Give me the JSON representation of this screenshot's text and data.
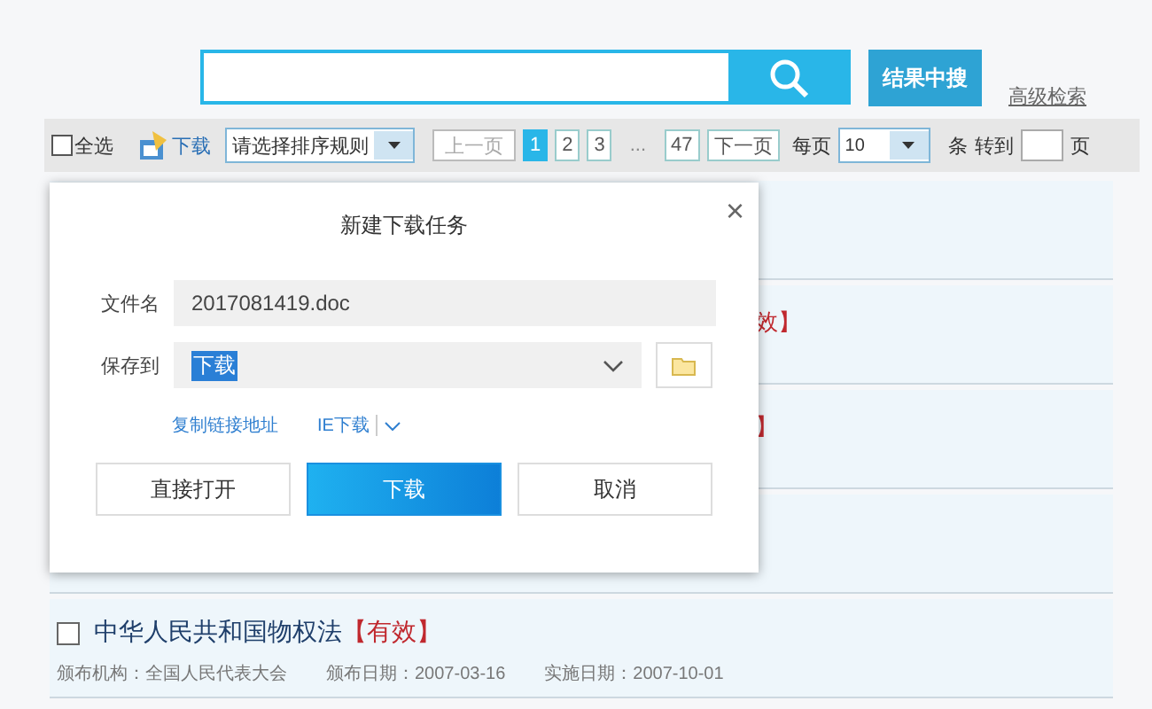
{
  "search": {
    "button_label": "结果中搜",
    "advanced_link": "高级检索"
  },
  "toolbar": {
    "select_all": {
      "label": "全选",
      "checked": false
    },
    "download": "下载",
    "sort_select": "请选择排序规则",
    "prev": "上一页",
    "pages": [
      {
        "label": "1",
        "selected": true
      },
      {
        "label": "2",
        "selected": false
      },
      {
        "label": "3",
        "selected": false
      }
    ],
    "ellipsis": "...",
    "last_page": "47",
    "next": "下一页",
    "per_page_label": "每页",
    "per_page_value": "10",
    "unit": "条",
    "goto_label": "转到",
    "page_suffix": "页"
  },
  "results": [
    {
      "kind": "blank"
    },
    {
      "kind": "fragment",
      "text": "效】"
    },
    {
      "kind": "fragment",
      "text": "】"
    },
    {
      "kind": "blank"
    },
    {
      "kind": "full",
      "checked": false,
      "title": "中华人民共和国物权法",
      "status": "【有效】",
      "meta": [
        "颁布机构：全国人民代表大会",
        "颁布日期：2007-03-16",
        "实施日期：2007-10-01"
      ]
    }
  ],
  "dialog": {
    "title": "新建下载任务",
    "close": "×",
    "filename_label": "文件名",
    "filename": "2017081419.doc",
    "save_label": "保存到",
    "save_to": "下载",
    "copy_link": "复制链接地址",
    "ie_download": "IE下载",
    "buttons": [
      "直接打开",
      "下载",
      "取消"
    ]
  }
}
